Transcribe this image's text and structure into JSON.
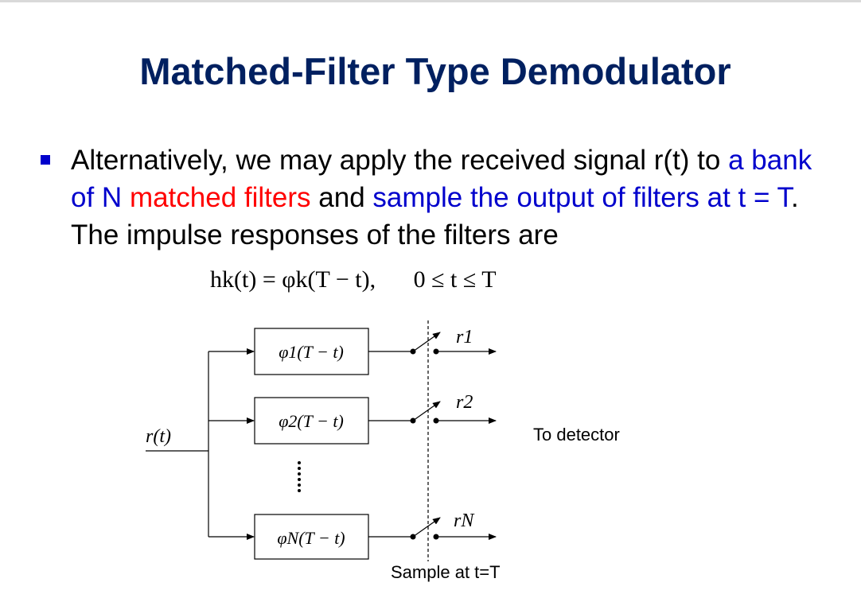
{
  "slide": {
    "title": "Matched-Filter Type Demodulator",
    "bullet": {
      "seg1": "Alternatively, we may apply the received signal r(t) to",
      "seg2": "a bank of N",
      "seg3": "matched filters",
      "seg4": "and",
      "seg5": "sample the output of filters at t = T",
      "seg6": ". The impulse responses of the filters are"
    },
    "equation": {
      "lhs": "hk(t) = φk(T − t),",
      "condition": "0 ≤ t ≤ T"
    },
    "colors": {
      "title": "#002060",
      "blue": "#0000cc",
      "red": "#ff0000"
    }
  },
  "diagram": {
    "input_label": "r(t)",
    "filters": [
      {
        "label": "φ1(T − t)",
        "output": "r1"
      },
      {
        "label": "φ2(T − t)",
        "output": "r2"
      },
      {
        "label": "φN(T − t)",
        "output": "rN"
      }
    ],
    "ellipsis": "⋮",
    "to_detector": "To detector",
    "sample_label": "Sample at t=T"
  }
}
